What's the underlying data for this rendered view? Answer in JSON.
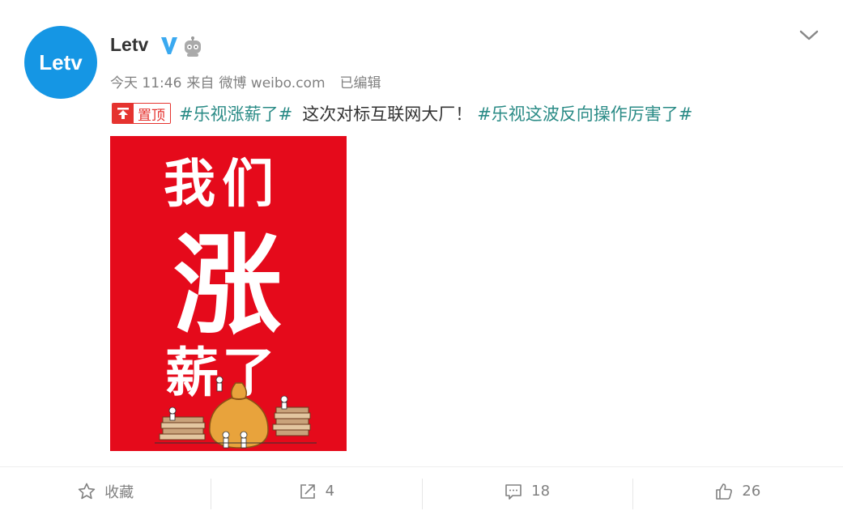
{
  "user": {
    "avatar_text": "Letv",
    "name": "Letv",
    "verified_icon": "verified-v-icon",
    "robot_icon": "robot-icon"
  },
  "meta": {
    "time": "今天 11:46",
    "source_prefix": "来自",
    "source": "微博 weibo.com",
    "edited": "已编辑"
  },
  "post": {
    "pin_label": "置顶",
    "hashtag1": "#乐视涨薪了#",
    "text": "这次对标互联网大厂！",
    "hashtag2": "#乐视这波反向操作厉害了#"
  },
  "image": {
    "line1": "我们",
    "line2": "涨",
    "line3": "薪了"
  },
  "actions": {
    "favorite_label": "收藏",
    "repost_count": "4",
    "comment_count": "18",
    "like_count": "26"
  },
  "colors": {
    "brand_blue": "#1596e4",
    "hashtag_green": "#2a8b86",
    "pin_red": "#e5332f",
    "image_red": "#e50a1b"
  }
}
